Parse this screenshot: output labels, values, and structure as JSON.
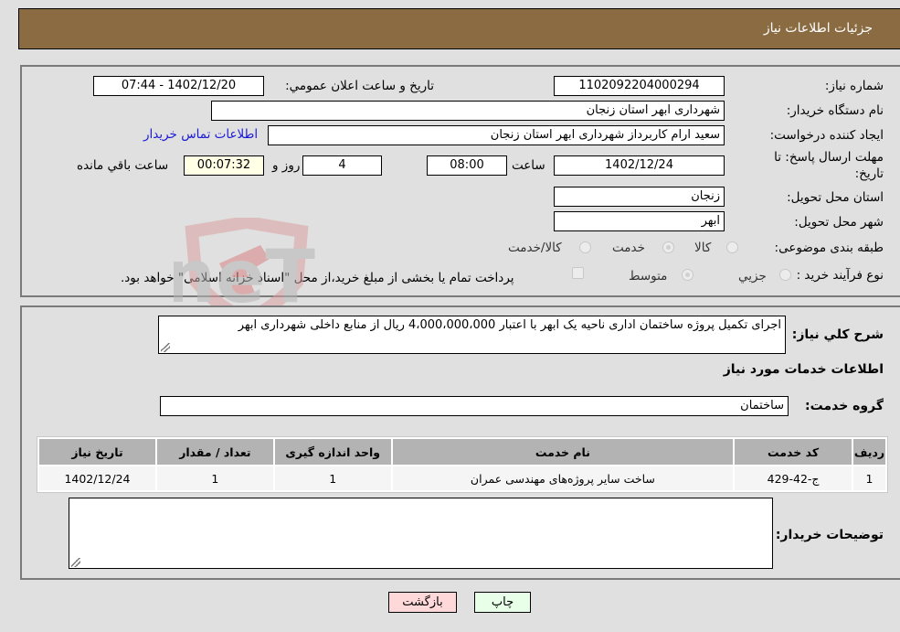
{
  "header": {
    "title": "جزئیات اطلاعات نیاز"
  },
  "form": {
    "need_number": {
      "label": "شماره نیاز:",
      "value": "1102092204000294"
    },
    "announce_datetime": {
      "label": "تاریخ و ساعت اعلان عمومي:",
      "value": "1402/12/20 - 07:44"
    },
    "buyer_org": {
      "label": "نام دستگاه خریدار:",
      "value": "شهرداری ابهر استان زنجان"
    },
    "requester": {
      "label": "ایجاد کننده درخواست:",
      "value": "سعید ارام کاربرداز  شهرداری ابهر استان زنجان"
    },
    "buyer_contact_link": "اطلاعات تماس خریدار",
    "deadline": {
      "label_line1": "مهلت ارسال پاسخ: تا",
      "label_line2": "تاریخ:",
      "date": "1402/12/24",
      "time_label": "ساعت",
      "time": "08:00",
      "days": "4",
      "days_label": "روز و",
      "remaining": "00:07:32",
      "remaining_label": "ساعت باقي مانده"
    },
    "delivery_province": {
      "label": "استان محل تحویل:",
      "value": "زنجان"
    },
    "delivery_city": {
      "label": "شهر محل تحویل:",
      "value": "ابهر"
    },
    "category": {
      "label": "طبقه بندی موضوعی:",
      "options": [
        "کالا",
        "خدمت",
        "کالا/خدمت"
      ],
      "selected": "خدمت"
    },
    "purchase_type": {
      "label": "نوع فرآیند خرید :",
      "options": [
        "جزیي",
        "متوسط"
      ],
      "selected": "متوسط",
      "treasury_note": "پرداخت تمام یا بخشی از مبلغ خرید،از محل \"اسناد خزانه اسلامی\" خواهد بود."
    }
  },
  "details": {
    "description_label": "شرح كلي نياز:",
    "description": "اجرای تکمیل پروژه ساختمان اداری ناحیه یک ابهر با اعتبار 4،000،000،000 ریال از منابع داخلی شهرداری ابهر",
    "services_heading": "اطلاعات خدمات مورد نیاز",
    "service_group_label": "گروه خدمت:",
    "service_group": "ساختمان",
    "table": {
      "headers": [
        "ردیف",
        "کد خدمت",
        "نام خدمت",
        "واحد اندازه گیری",
        "تعداد / مقدار",
        "تاریخ نیاز"
      ],
      "rows": [
        [
          "1",
          "ج-42-429",
          "ساخت سایر پروژه‌های مهندسی عمران",
          "1",
          "1",
          "1402/12/24"
        ]
      ]
    },
    "buyer_notes_label": "توضیحات خریدار:",
    "buyer_notes": ""
  },
  "buttons": {
    "print": "چاپ",
    "back": "بازگشت"
  },
  "watermark": {
    "text": "AriaTender.neT"
  }
}
